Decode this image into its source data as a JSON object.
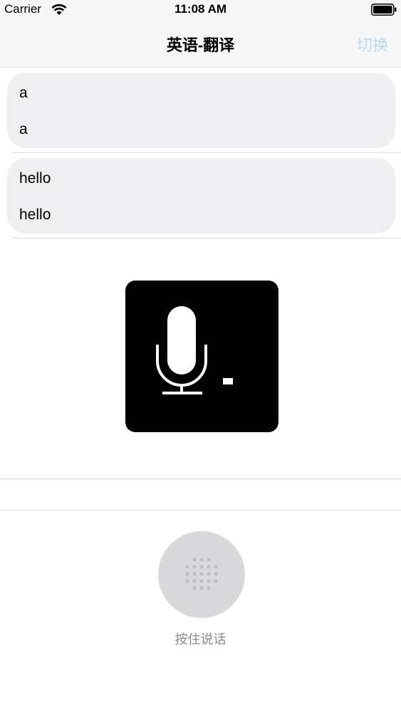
{
  "status_bar": {
    "carrier": "Carrier",
    "time": "11:08 AM",
    "icons": [
      "wifi-icon",
      "battery-icon"
    ]
  },
  "nav": {
    "title": "英语-翻译",
    "switch_label": "切换",
    "switch_color": "#b9daf4"
  },
  "translations": [
    {
      "source": "a",
      "result": "a"
    },
    {
      "source": "hello",
      "result": "hello"
    }
  ],
  "mic_overlay": {
    "icon": "microphone-icon",
    "level_icon": "volume-level-icon"
  },
  "talk": {
    "icon": "dots-grid-icon",
    "label": "按住说话"
  }
}
